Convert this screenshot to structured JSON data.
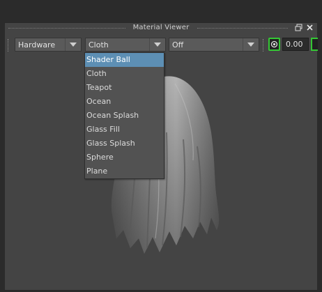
{
  "window": {
    "title": "Material Viewer",
    "restore_icon": "restore-window-icon",
    "close_icon": "close-icon"
  },
  "toolbar": {
    "renderer": {
      "value": "Hardware"
    },
    "geometry": {
      "value": "Cloth"
    },
    "environment": {
      "value": "Off"
    },
    "exposure_value": "0.00",
    "accent_color": "#34c834"
  },
  "geometry_menu": {
    "items": [
      "Shader Ball",
      "Cloth",
      "Teapot",
      "Ocean",
      "Ocean Splash",
      "Glass Fill",
      "Glass Splash",
      "Sphere",
      "Plane"
    ],
    "highlighted": "Shader Ball",
    "highlight_color": "#5d8fb4"
  },
  "viewport": {
    "preview": "cloth-drape-preview"
  }
}
